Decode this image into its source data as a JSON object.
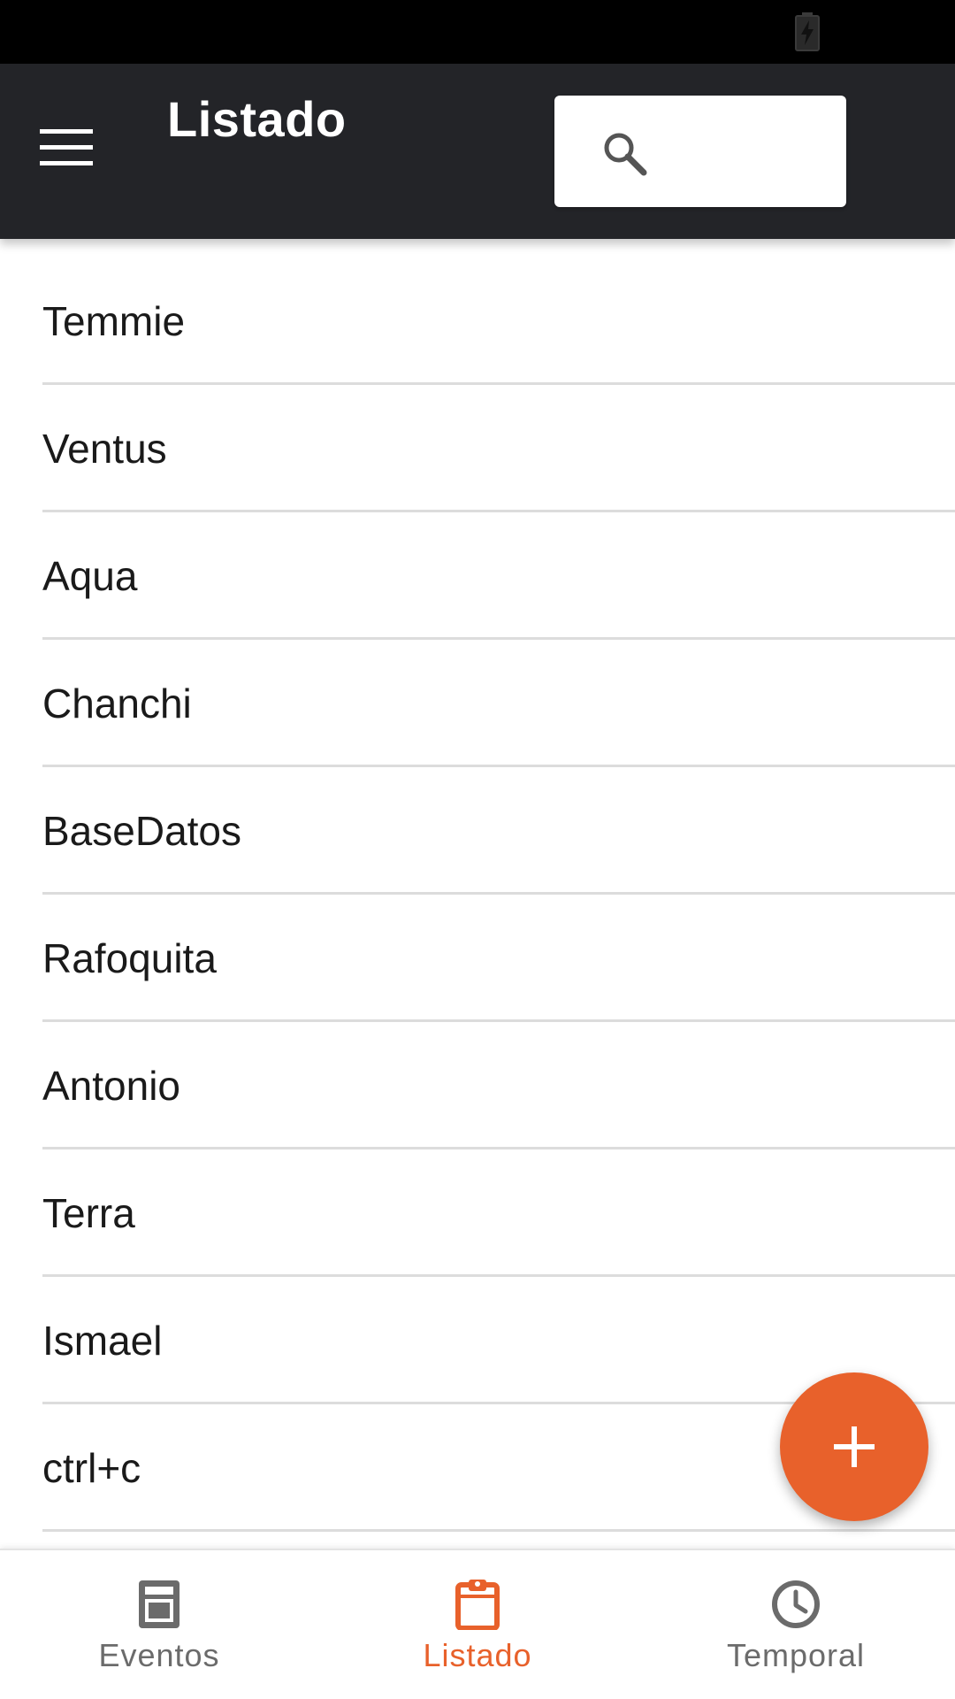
{
  "colors": {
    "toolbar_bg": "#232428",
    "accent": "#e8612b",
    "inactive": "#6b6b6b",
    "divider": "#dcdcdc"
  },
  "status_bar": {
    "icons": [
      "battery-charging-icon"
    ]
  },
  "toolbar": {
    "menu_icon": "hamburger-menu-icon",
    "title": "Listado",
    "search": {
      "icon": "search-icon",
      "value": "",
      "placeholder": ""
    }
  },
  "list": {
    "items": [
      "Temmie",
      "Ventus",
      "Aqua",
      "Chanchi",
      "BaseDatos",
      "Rafoquita",
      "Antonio",
      "Terra",
      "Ismael",
      "ctrl+c"
    ]
  },
  "fab": {
    "icon": "plus-icon"
  },
  "bottom_nav": {
    "tabs": [
      {
        "label": "Eventos",
        "icon": "calculator-icon",
        "active": false
      },
      {
        "label": "Listado",
        "icon": "clipboard-icon",
        "active": true
      },
      {
        "label": "Temporal",
        "icon": "clock-icon",
        "active": false
      }
    ]
  }
}
